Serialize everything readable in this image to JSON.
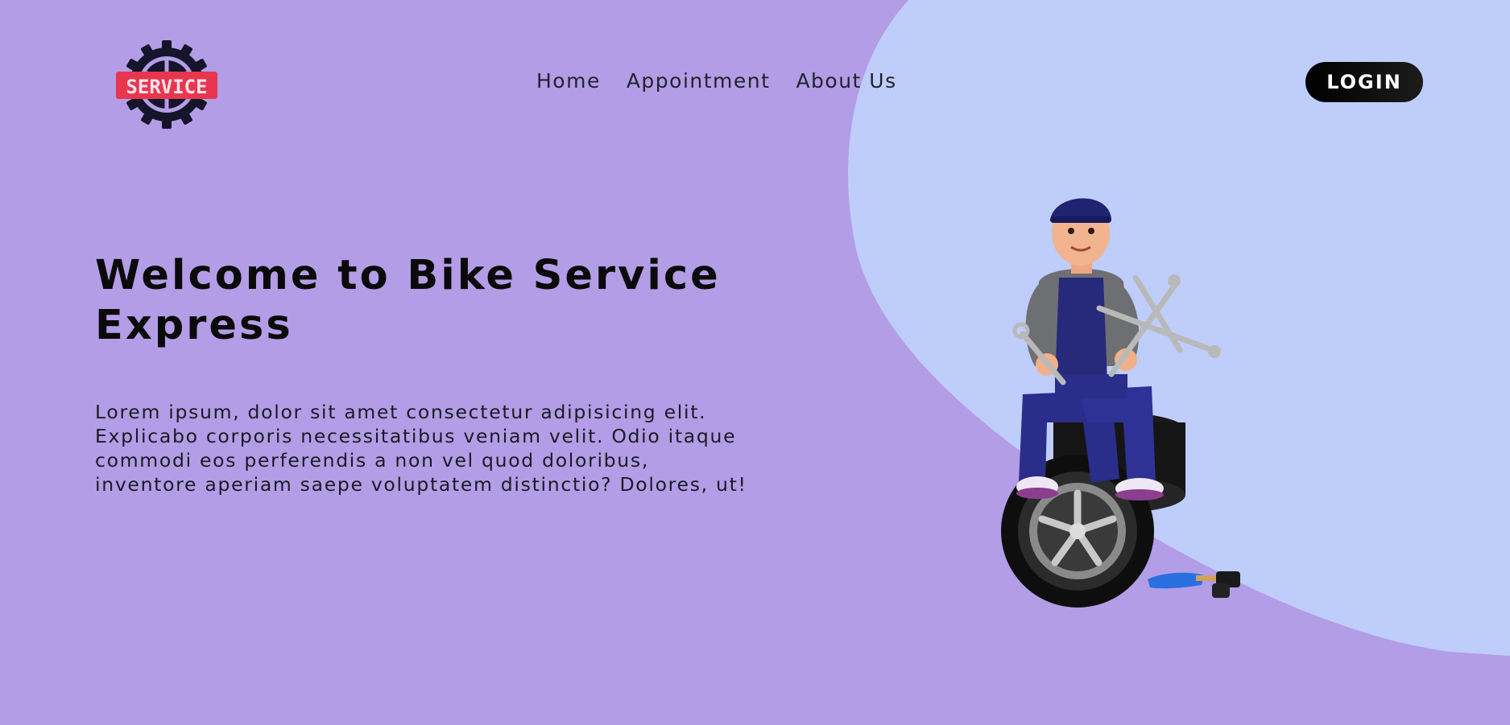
{
  "colors": {
    "background": "#b39de6",
    "blob": "#bfcdfb",
    "logo_red": "#e8364f",
    "logo_dark": "#14142a",
    "login_bg": "#000000",
    "login_text": "#ffffff"
  },
  "logo": {
    "text": "SERVICE",
    "icon": "gear-wheel-icon"
  },
  "nav": {
    "items": [
      {
        "label": "Home"
      },
      {
        "label": "Appointment"
      },
      {
        "label": "About Us"
      }
    ]
  },
  "header": {
    "login_label": "LOGIN"
  },
  "hero": {
    "title": "Welcome to Bike Service Express",
    "description": "Lorem ipsum, dolor sit amet consectetur adipisicing elit. Explicabo corporis necessitatibus veniam velit. Odio itaque commodi eos perferendis a non vel quod doloribus, inventore aperiam saepe voluptatem distinctio? Dolores, ut!",
    "illustration": "mechanic-with-tires-illustration"
  }
}
